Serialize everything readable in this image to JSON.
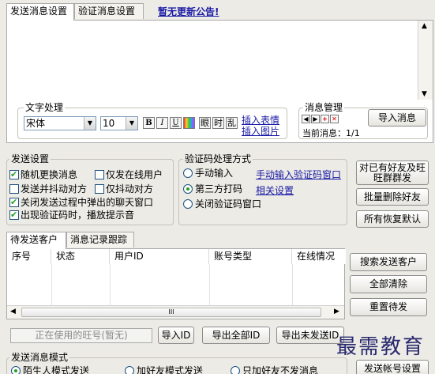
{
  "tabs_top": {
    "send_settings": "发送消息设置",
    "verify_settings": "验证消息设置",
    "notice": "暂无更新公告!"
  },
  "text_processing": {
    "title": "文字处理",
    "font_name": "宋体",
    "font_size": "10",
    "bold": "B",
    "italic": "I",
    "underline": "U",
    "btn_a": "眼",
    "btn_b": "时",
    "btn_c": "乱",
    "insert_emoji": "插入表情",
    "insert_image": "插入图片"
  },
  "message_mgmt": {
    "title": "消息管理",
    "import_btn": "导入消息",
    "current_label": "当前消息：1/1"
  },
  "send_settings": {
    "title": "发送设置",
    "opt1": "随机更换消息",
    "opt2": "仅发在线用户",
    "opt3": "发送并抖动对方",
    "opt4": "仅抖动对方",
    "opt5": "关闭发送过程中弹出的聊天窗口",
    "opt6": "出现验证码时，播放提示音"
  },
  "captcha": {
    "title": "验证码处理方式",
    "manual": "手动输入",
    "manual_link": "手动输入验证码窗口",
    "third_party": "第三方打码",
    "third_party_link": "相关设置",
    "close_window": "关闭验证码窗口"
  },
  "right_actions": {
    "friends_group": "对已有好友及旺旺群群发",
    "batch_delete": "批量删除好友",
    "restore_default": "所有恢复默认"
  },
  "tabs_bottom": {
    "pending": "待发送客户",
    "history": "消息记录跟踪"
  },
  "table": {
    "columns": [
      "序号",
      "状态",
      "用户ID",
      "账号类型",
      "在线情况"
    ]
  },
  "list_actions": {
    "search": "搜索发送客户",
    "clear": "全部清除",
    "reset": "重置待发"
  },
  "bottom_bar": {
    "current_ww_placeholder": "正在使用的旺号(暂无)",
    "import_id": "导入ID",
    "export_all": "导出全部ID",
    "export_unsent": "导出未发送ID",
    "send_account_settings": "发送帐号设置"
  },
  "send_mode": {
    "title": "发送消息模式",
    "opt1": "陌生人模式发送",
    "opt2": "加好友模式发送",
    "opt3": "只加好友不发消息"
  },
  "watermark": "最需教育"
}
